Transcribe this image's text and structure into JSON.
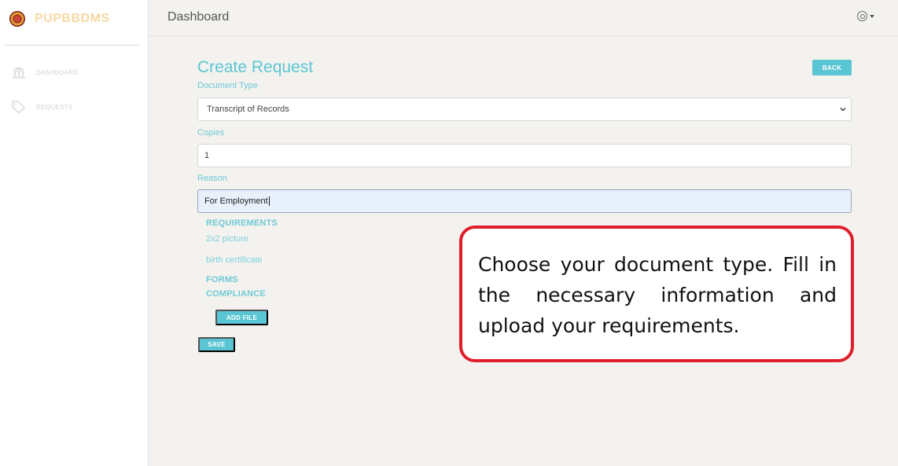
{
  "sidebar": {
    "brand": "PUPBBDMS",
    "items": [
      {
        "label": "DASHBOARD",
        "icon": "bank-icon"
      },
      {
        "label": "REQUESTS",
        "icon": "tags-icon"
      }
    ]
  },
  "topbar": {
    "title": "Dashboard",
    "user_icon": "user-circle-icon"
  },
  "form": {
    "title": "Create Request",
    "back_label": "BACK",
    "document_type_label": "Document Type",
    "document_type_value": "Transcript of Records",
    "copies_label": "Copies",
    "copies_value": "1",
    "reason_label": "Reason",
    "reason_value": "For Employment",
    "requirements_heading": "REQUIREMENTS",
    "requirements": [
      "2x2 picture",
      "birth certificate"
    ],
    "forms_heading": "FORMS",
    "compliance_heading": "COMPLIANCE",
    "add_file_label": "ADD FILE",
    "save_label": "SAVE"
  },
  "callout": {
    "text": "Choose your document type. Fill in the necessary information and upload your requirements."
  },
  "colors": {
    "accent": "#5bc6d3",
    "callout_border": "#e01e2b"
  }
}
